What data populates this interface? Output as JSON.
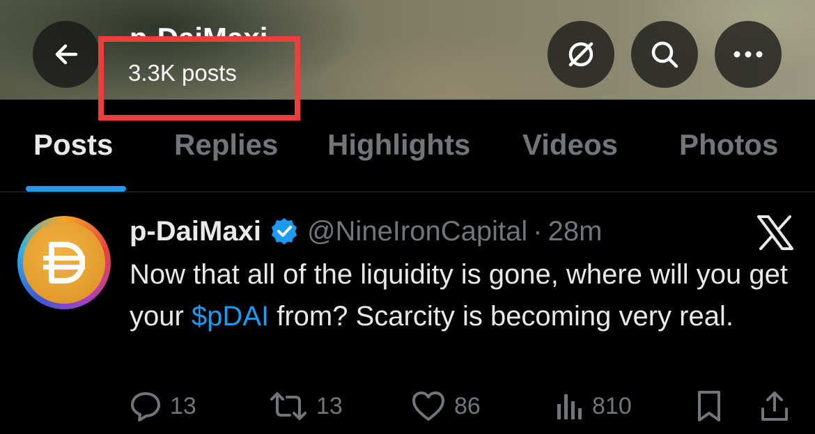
{
  "header": {
    "title": "p-DaiMaxi",
    "posts_count": "3.3K posts",
    "back_label": "back",
    "grok_label": "grok",
    "search_label": "search",
    "more_label": "more"
  },
  "tabs": [
    {
      "label": "Posts",
      "active": true
    },
    {
      "label": "Replies",
      "active": false
    },
    {
      "label": "Highlights",
      "active": false
    },
    {
      "label": "Videos",
      "active": false
    },
    {
      "label": "Photos",
      "active": false
    }
  ],
  "tweet": {
    "author_name": "p-DaiMaxi",
    "verified": true,
    "handle": "@NineIronCapital",
    "separator": "·",
    "time": "28m",
    "text_before": "Now that all of the liquidity is gone, where will you get your ",
    "cashtag": "$pDAI",
    "text_after": " from? Scarcity is becoming very real.",
    "replies": "13",
    "reposts": "13",
    "likes": "86",
    "views": "810"
  },
  "colors": {
    "accent": "#1d9bf0",
    "muted": "#71767b",
    "highlight_box": "#ee3e3c",
    "background": "#000000"
  },
  "icons": [
    "arrow-left-icon",
    "grok-icon",
    "search-icon",
    "more-icon",
    "verified-badge-icon",
    "x-logo-icon",
    "reply-icon",
    "repost-icon",
    "like-icon",
    "views-icon",
    "bookmark-icon",
    "share-icon",
    "dai-logo-icon"
  ]
}
